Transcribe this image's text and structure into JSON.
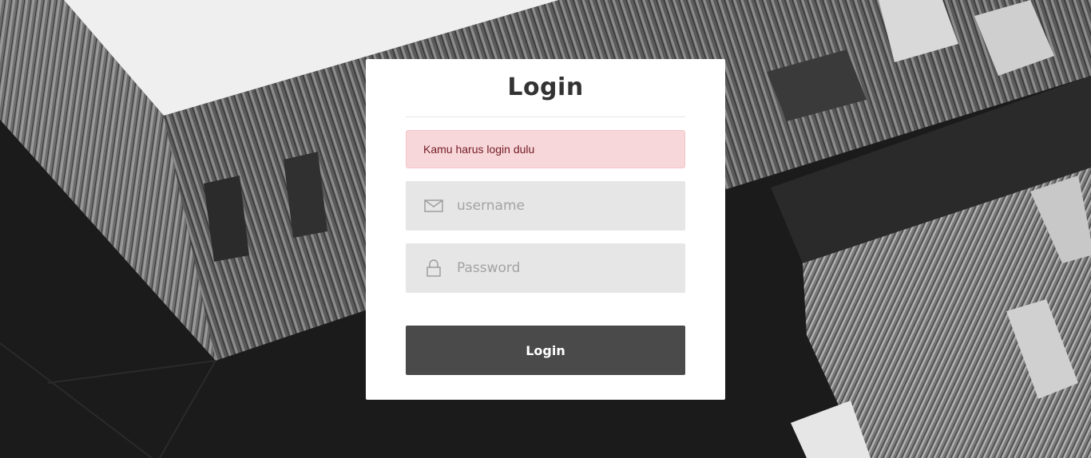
{
  "login": {
    "title": "Login",
    "alert_message": "Kamu harus login dulu",
    "username": {
      "placeholder": "username",
      "value": "",
      "icon": "envelope-icon"
    },
    "password": {
      "placeholder": "Password",
      "value": "",
      "icon": "lock-icon"
    },
    "submit_label": "Login"
  },
  "colors": {
    "card_background": "#ffffff",
    "alert_background": "#f8d7da",
    "alert_text": "#721c24",
    "field_background": "#e6e6e6",
    "button_background": "#4a4a4a",
    "button_text": "#ffffff"
  }
}
